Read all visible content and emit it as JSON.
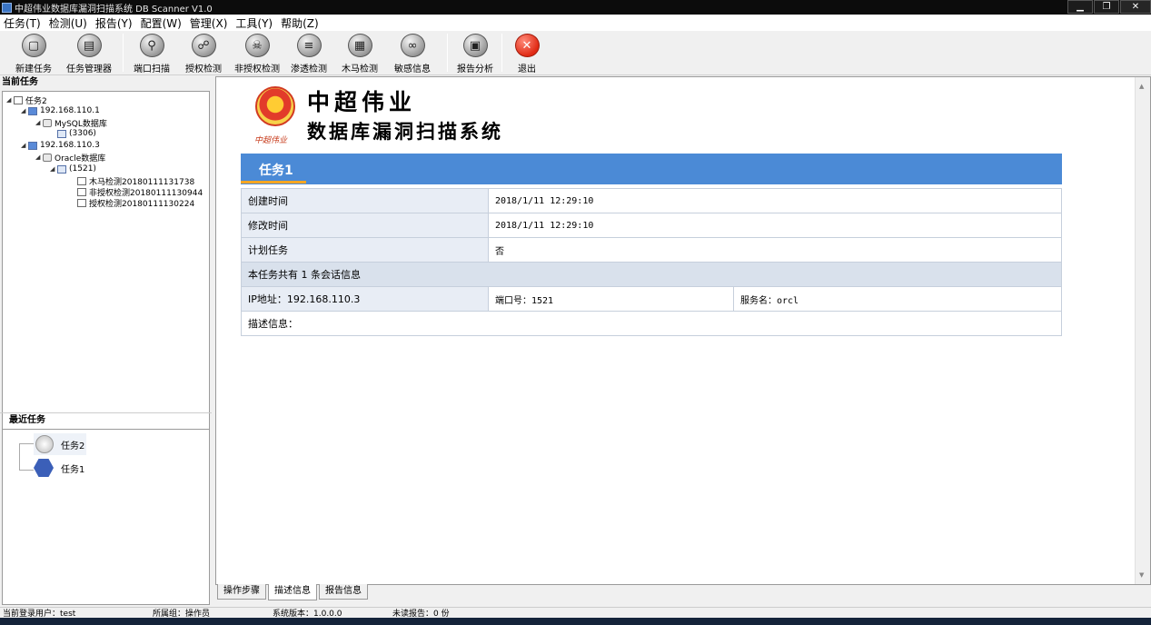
{
  "window": {
    "title": "中超伟业数据库漏洞扫描系统 DB Scanner V1.0",
    "minimize": "▁",
    "maximize": "❐",
    "close": "✕"
  },
  "menu": [
    "任务(T)",
    "检测(U)",
    "报告(Y)",
    "配置(W)",
    "管理(X)",
    "工具(Y)",
    "帮助(Z)"
  ],
  "toolbar": [
    {
      "label": "新建任务",
      "icon": "new-task-icon",
      "glyph": "▢"
    },
    {
      "label": "任务管理器",
      "icon": "task-manager-icon",
      "glyph": "▤"
    },
    {
      "label": "端口扫描",
      "icon": "port-scan-icon",
      "glyph": "⚲"
    },
    {
      "label": "授权检测",
      "icon": "authorized-check-icon",
      "glyph": "☍"
    },
    {
      "label": "非授权检测",
      "icon": "unauthorized-check-icon",
      "glyph": "☠"
    },
    {
      "label": "渗透检测",
      "icon": "penetration-test-icon",
      "glyph": "≡"
    },
    {
      "label": "木马检测",
      "icon": "trojan-check-icon",
      "glyph": "▦"
    },
    {
      "label": "敏感信息",
      "icon": "sensitive-info-icon",
      "glyph": "∞"
    },
    {
      "label": "报告分析",
      "icon": "report-analysis-icon",
      "glyph": "▣"
    },
    {
      "label": "退出",
      "icon": "exit-icon",
      "glyph": "✕"
    }
  ],
  "left": {
    "current_title": "当前任务",
    "tree": {
      "task": "任务2",
      "host1": "192.168.110.1",
      "db1": "MySQL数据库",
      "port1": "(3306)",
      "host2": "192.168.110.3",
      "db2": "Oracle数据库",
      "port2": "(1521)",
      "checks": [
        "木马检测20180111131738",
        "非授权检测20180111130944",
        "授权检测20180111130224"
      ]
    },
    "recent_title": "最近任务",
    "recent": [
      "任务2",
      "任务1"
    ]
  },
  "main": {
    "brand_caption": "中超伟业",
    "brand_line1": "中超伟业",
    "brand_line2": "数据库漏洞扫描系统",
    "task_name": "任务1",
    "rows": {
      "created_label": "创建时间",
      "created_value": "2018/1/11 12:29:10",
      "modified_label": "修改时间",
      "modified_value": "2018/1/11 12:29:10",
      "scheduled_label": "计划任务",
      "scheduled_value": "否",
      "session_summary": "本任务共有 1 条会话信息",
      "ip": "IP地址：192.168.110.3",
      "port": "端口号：1521",
      "service": "服务名：orcl",
      "description": "描述信息："
    }
  },
  "tabs": [
    "操作步骤",
    "描述信息",
    "报告信息"
  ],
  "status": {
    "user": "当前登录用户：test",
    "group": "所属组：操作员",
    "version": "系统版本：1.0.0.0",
    "unread": "未读报告：0 份"
  }
}
